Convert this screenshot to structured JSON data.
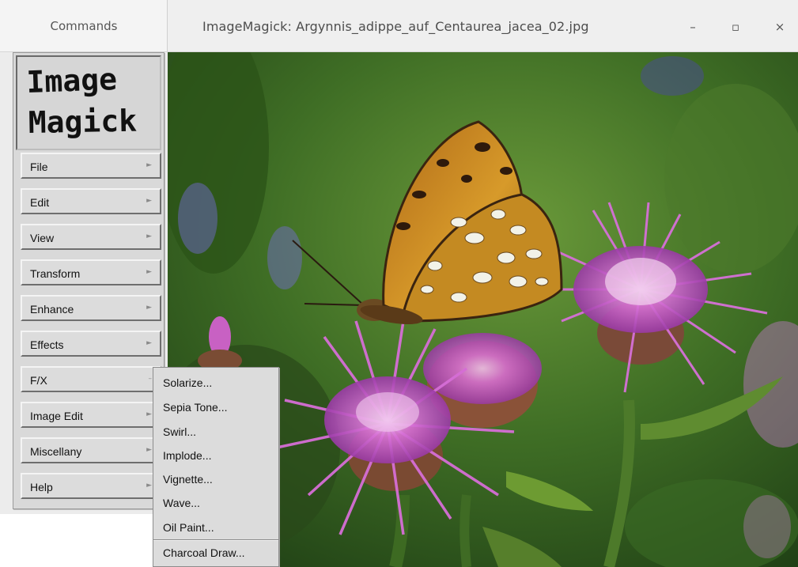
{
  "image_window": {
    "title": "ImageMagick: Argynnis_adippe_auf_Centaurea_jacea_02.jpg",
    "minimize": "–",
    "maximize": "▫",
    "close": "×",
    "image_description_icon": "photo-image"
  },
  "commands_window": {
    "title": "Commands",
    "logo": {
      "line1": "Image",
      "line2": "Magick"
    },
    "menu": [
      {
        "label": "File",
        "arrow": "►"
      },
      {
        "label": "Edit",
        "arrow": "►"
      },
      {
        "label": "View",
        "arrow": "►"
      },
      {
        "label": "Transform",
        "arrow": "►"
      },
      {
        "label": "Enhance",
        "arrow": "►"
      },
      {
        "label": "Effects",
        "arrow": "►"
      },
      {
        "label": "F/X",
        "arrow": "–"
      },
      {
        "label": "Image Edit",
        "arrow": "►"
      },
      {
        "label": "Miscellany",
        "arrow": "►"
      },
      {
        "label": "Help",
        "arrow": "►"
      }
    ]
  },
  "fx_submenu": {
    "items": [
      "Solarize...",
      "Sepia Tone...",
      "Swirl...",
      "Implode...",
      "Vignette...",
      "Wave...",
      "Oil Paint...",
      "Charcoal Draw..."
    ]
  },
  "colors": {
    "foliage_dark": "#2f5a1c",
    "foliage_light": "#6d9a3a",
    "flower_pink": "#c25ac8",
    "butterfly_orange": "#c47a1c"
  }
}
